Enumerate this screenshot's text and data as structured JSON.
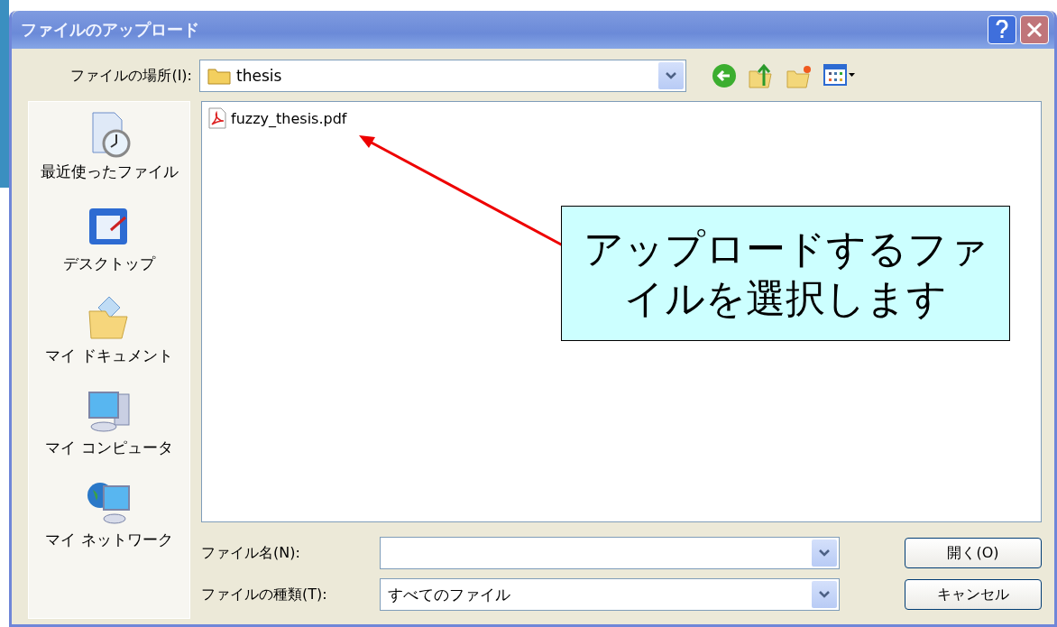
{
  "window": {
    "title": "ファイルのアップロード"
  },
  "location": {
    "label": "ファイルの場所(I):",
    "value": "thesis"
  },
  "places": [
    {
      "kind": "recent",
      "label": "最近使ったファイル"
    },
    {
      "kind": "desktop",
      "label": "デスクトップ"
    },
    {
      "kind": "documents",
      "label": "マイ ドキュメント"
    },
    {
      "kind": "computer",
      "label": "マイ コンピュータ"
    },
    {
      "kind": "network",
      "label": "マイ ネットワーク"
    }
  ],
  "files": [
    {
      "name": "fuzzy_thesis.pdf"
    }
  ],
  "callout": {
    "text": "アップロードするファイルを選択します"
  },
  "filename": {
    "label": "ファイル名(N):"
  },
  "filetype": {
    "label": "ファイルの種類(T):",
    "value": "すべてのファイル"
  },
  "buttons": [
    {
      "label": "開く(O)"
    },
    {
      "label": "キャンセル"
    }
  ]
}
